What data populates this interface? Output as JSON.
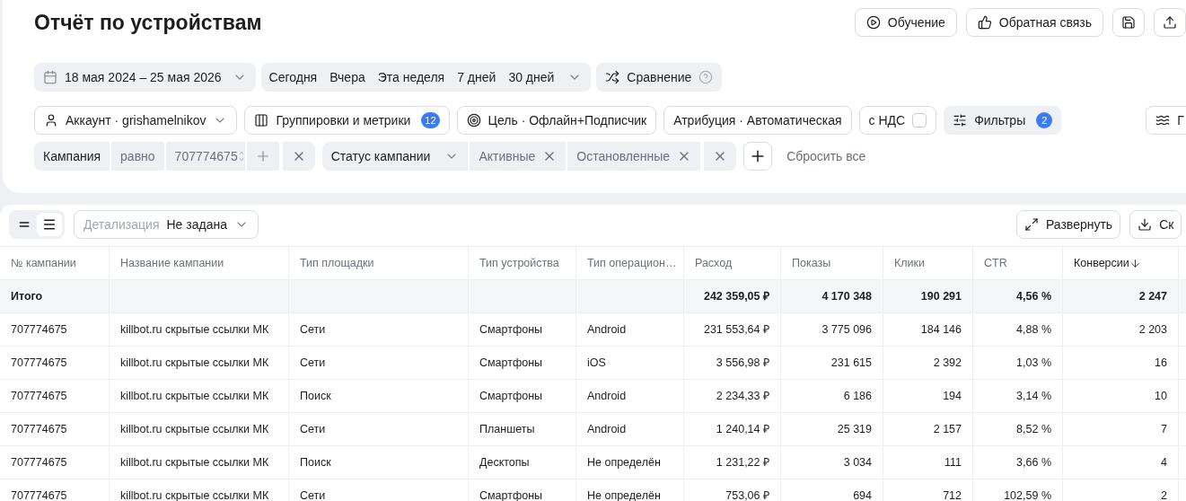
{
  "header": {
    "title": "Отчёт по устройствам",
    "buttons": [
      {
        "kind": "play",
        "label": "Обучение"
      },
      {
        "kind": "like",
        "label": "Обратная связь"
      },
      {
        "kind": "save"
      },
      {
        "kind": "upload"
      }
    ]
  },
  "period": {
    "date_range": "18 мая 2024 – 25 мая 2026",
    "presets": [
      "Сегодня",
      "Вчера",
      "Эта неделя",
      "7 дней",
      "30 дней"
    ],
    "compare": "Сравнение"
  },
  "settings": [
    {
      "kind": "account",
      "label": "Аккаунт · grishamelnikov"
    },
    {
      "kind": "groupings",
      "label": "Группировки и метрики",
      "badge": "12"
    },
    {
      "kind": "goal",
      "label": "Цель · Офлайн+Подписчик"
    },
    {
      "kind": "plain",
      "label": "Атрибуция · Автоматическая"
    },
    {
      "kind": "vat",
      "label": "с НДС",
      "checked": false
    },
    {
      "kind": "filters",
      "label": "Фильтры",
      "badge": "2"
    },
    {
      "kind": "chart",
      "label": "Г"
    }
  ],
  "filters": [
    {
      "field": "Кампания",
      "operator": "равно",
      "value": "707774675"
    },
    {
      "field": "Статус кампании",
      "values": [
        "Активные",
        "Остановленные"
      ]
    }
  ],
  "reset": "Сбросить все",
  "toolbar": {
    "views": [
      {
        "kind": "compact",
        "selected": false
      },
      {
        "kind": "list",
        "selected": true
      }
    ],
    "detail": {
      "label": "Детализация",
      "value": "Не задана"
    },
    "buttons": [
      {
        "kind": "expand",
        "label": "Развернуть"
      },
      {
        "kind": "download",
        "label": "Ск"
      }
    ]
  },
  "table": {
    "columns": [
      {
        "label": "№ кампании",
        "sorted": false
      },
      {
        "label": "Название кампании",
        "sorted": false
      },
      {
        "label": "Тип площадки",
        "sorted": false
      },
      {
        "label": "Тип устройства",
        "sorted": false
      },
      {
        "label": "Тип операцион…",
        "sorted": false
      },
      {
        "label": "Расход",
        "sorted": false
      },
      {
        "label": "Показы",
        "sorted": false
      },
      {
        "label": "Клики",
        "sorted": false
      },
      {
        "label": "CTR",
        "sorted": false
      },
      {
        "label": "Конверсии",
        "sorted": true
      }
    ],
    "total": {
      "label": "Итого",
      "values": [
        "242 359,05 ₽",
        "4 170 348",
        "190 291",
        "4,56 %",
        "2 247"
      ]
    },
    "rows": [
      [
        "707774675",
        "killbot.ru скрытые ссылки МК",
        "Сети",
        "Смартфоны",
        "Android",
        "231 553,64 ₽",
        "3 775 096",
        "184 146",
        "4,88 %",
        "2 203"
      ],
      [
        "707774675",
        "killbot.ru скрытые ссылки МК",
        "Сети",
        "Смартфоны",
        "iOS",
        "3 556,98 ₽",
        "231 615",
        "2 392",
        "1,03 %",
        "16"
      ],
      [
        "707774675",
        "killbot.ru скрытые ссылки МК",
        "Поиск",
        "Смартфоны",
        "Android",
        "2 234,33 ₽",
        "6 186",
        "194",
        "3,14 %",
        "10"
      ],
      [
        "707774675",
        "killbot.ru скрытые ссылки МК",
        "Сети",
        "Планшеты",
        "Android",
        "1 240,14 ₽",
        "25 319",
        "2 157",
        "8,52 %",
        "7"
      ],
      [
        "707774675",
        "killbot.ru скрытые ссылки МК",
        "Поиск",
        "Десктопы",
        "Не определён",
        "1 231,22 ₽",
        "3 034",
        "111",
        "3,66 %",
        "4"
      ],
      [
        "707774675",
        "killbot.ru скрытые ссылки МК",
        "Сети",
        "Смартфоны",
        "Не определён",
        "753,06 ₽",
        "694",
        "712",
        "102,59 %",
        "2"
      ]
    ]
  }
}
